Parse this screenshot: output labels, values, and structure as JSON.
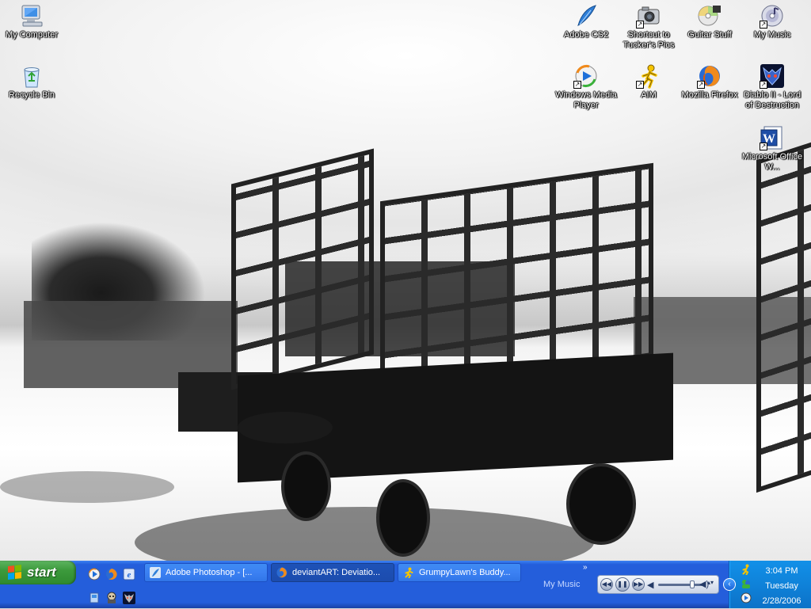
{
  "desktop": {
    "icons_left": [
      {
        "name": "my-computer",
        "label": "My Computer",
        "icon": "computer-icon",
        "shortcut": false
      },
      {
        "name": "recycle-bin",
        "label": "Recycle Bin",
        "icon": "recycle-bin-icon",
        "shortcut": false
      }
    ],
    "icons_right": [
      {
        "name": "adobe-cs2",
        "label": "Adobe CS2",
        "icon": "adobe-feather-icon",
        "shortcut": false
      },
      {
        "name": "tuckers-pics",
        "label": "Shortcut to Tucker's Pics",
        "icon": "camera-icon",
        "shortcut": true
      },
      {
        "name": "guitar-stuff",
        "label": "Guitar Stuff",
        "icon": "cd-folder-icon",
        "shortcut": false
      },
      {
        "name": "my-music",
        "label": "My Music",
        "icon": "music-disc-icon",
        "shortcut": true
      },
      {
        "name": "windows-media-player",
        "label": "Windows Media Player",
        "icon": "media-player-icon",
        "shortcut": true
      },
      {
        "name": "aim",
        "label": "AIM",
        "icon": "aim-runner-icon",
        "shortcut": true
      },
      {
        "name": "mozilla-firefox",
        "label": "Mozilla Firefox",
        "icon": "firefox-icon",
        "shortcut": true
      },
      {
        "name": "diablo-ii",
        "label": "Diablo II - Lord of Destruction",
        "icon": "diablo-icon",
        "shortcut": true
      },
      {
        "name": "microsoft-word",
        "label": "Microsoft Office W...",
        "icon": "word-icon",
        "shortcut": true
      }
    ]
  },
  "taskbar": {
    "start_label": "start",
    "quick_launch": [
      "media-player-icon",
      "firefox-icon",
      "browser-icon",
      "desktop-icon",
      "game-character-icon",
      "diablo-icon"
    ],
    "tasks": [
      {
        "label": "Adobe Photoshop - [...",
        "icon": "photoshop-icon",
        "active": false
      },
      {
        "label": "deviantART: Deviatio...",
        "icon": "firefox-icon",
        "active": true
      },
      {
        "label": "GrumpyLawn's Buddy...",
        "icon": "aim-runner-icon",
        "active": false
      }
    ],
    "expand_glyph": "»",
    "media_toolbar_label": "My Music",
    "tray": {
      "time": "3:04 PM",
      "day": "Tuesday",
      "date": "2/28/2006"
    }
  },
  "colors": {
    "taskbar_blue": "#245edb",
    "start_green": "#3c9a3c",
    "tray_blue": "#0f82d9"
  }
}
